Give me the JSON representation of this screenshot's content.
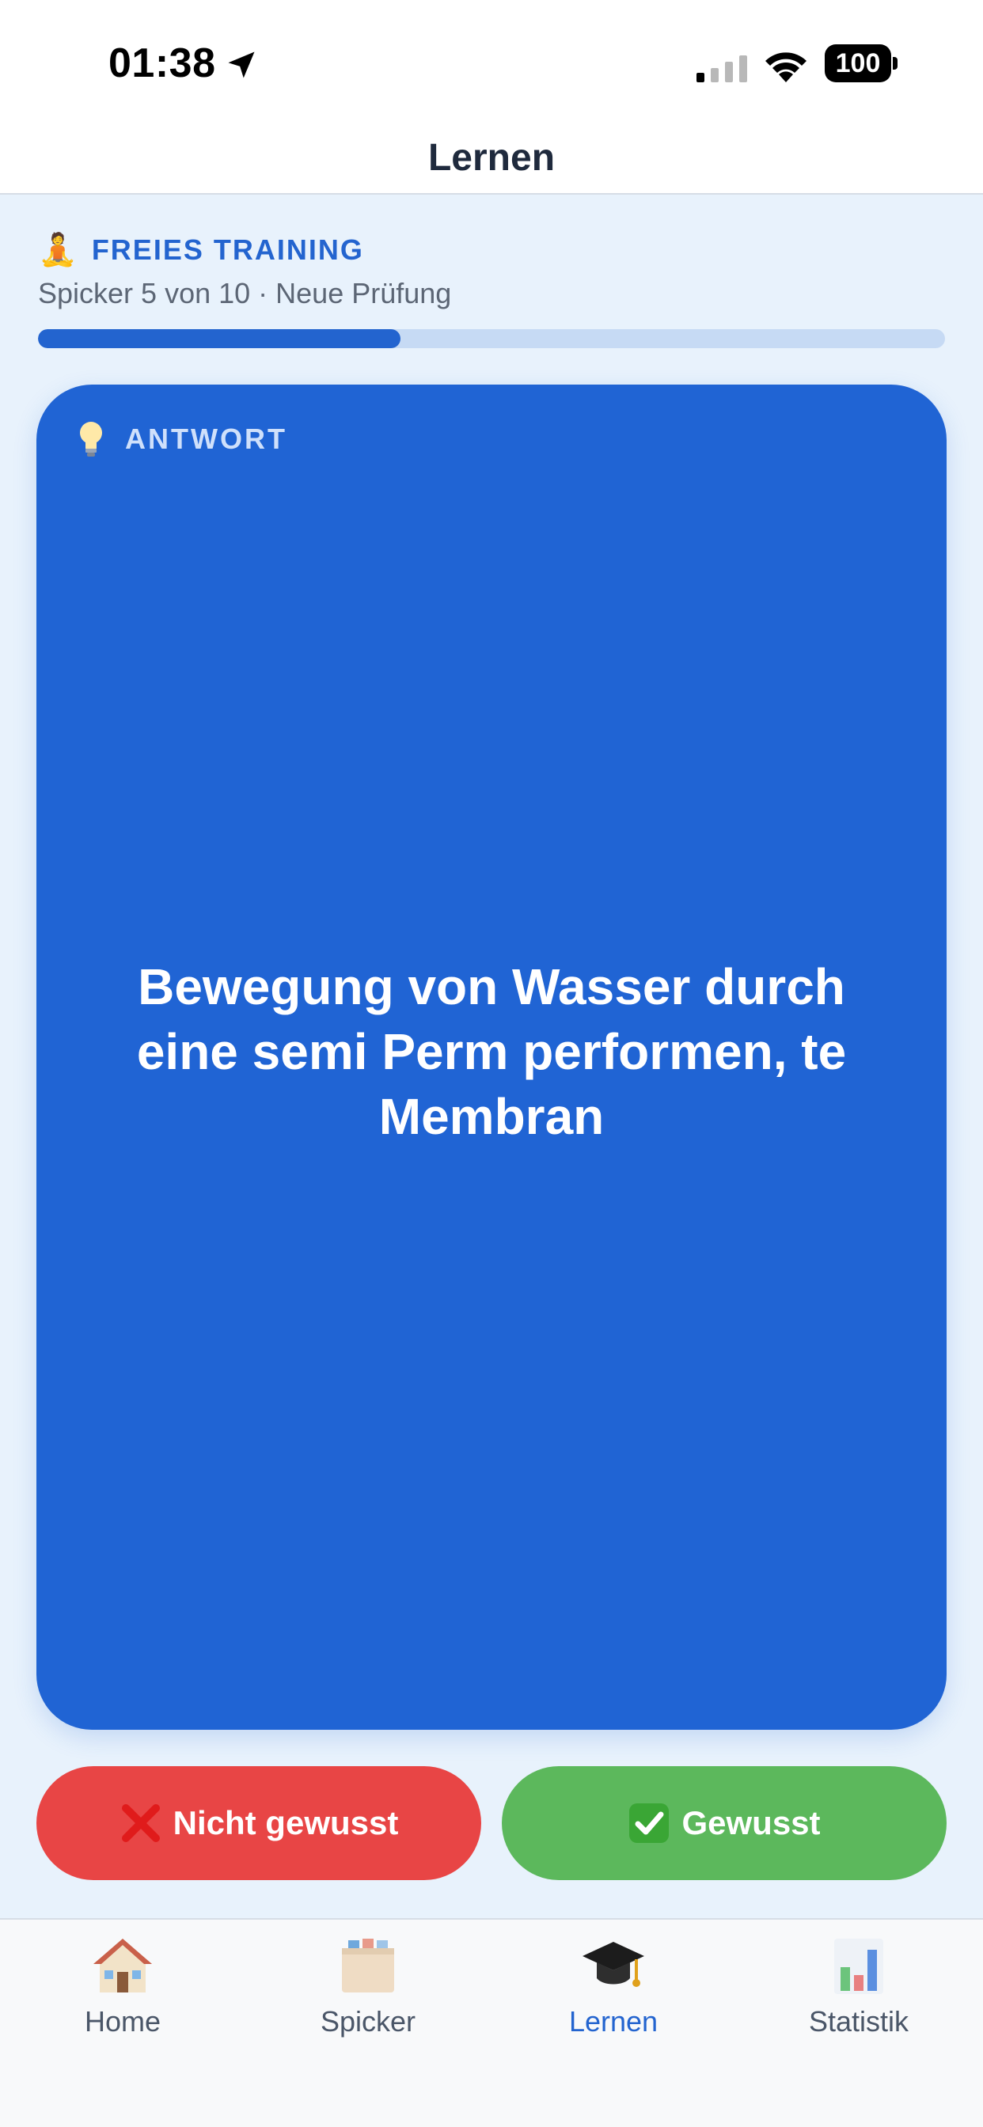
{
  "status_bar": {
    "time": "01:38",
    "battery": "100"
  },
  "header": {
    "title": "Lernen"
  },
  "session": {
    "mode_label": "FREIES TRAINING",
    "progress_text": "Spicker 5 von 10 · Neue Prüfung",
    "progress_fraction": 0.4
  },
  "card": {
    "label": "ANTWORT",
    "text": "Bewegung von Wasser durch eine semi Perm performen, te Membran"
  },
  "actions": {
    "not_known_label": "Nicht gewusst",
    "known_label": "Gewusst"
  },
  "tabs": [
    {
      "label": "Home",
      "icon": "house-icon",
      "active": false
    },
    {
      "label": "Spicker",
      "icon": "card-box-icon",
      "active": false
    },
    {
      "label": "Lernen",
      "icon": "graduation-cap-icon",
      "active": true
    },
    {
      "label": "Statistik",
      "icon": "bar-chart-icon",
      "active": false
    }
  ],
  "colors": {
    "accent": "#2364cf",
    "card_bg": "#2064d4",
    "danger": "#e84545",
    "success": "#5cb85c",
    "page_bg": "#e8f2fc"
  }
}
